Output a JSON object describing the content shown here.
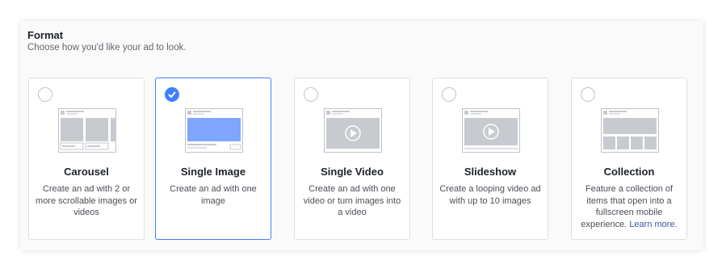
{
  "section": {
    "title": "Format",
    "subtitle": "Choose how you'd like your ad to look."
  },
  "formats": [
    {
      "name": "Carousel",
      "description": "Create an ad with 2 or more scrollable images or videos",
      "selected": false,
      "icon": "carousel-preview-icon"
    },
    {
      "name": "Single Image",
      "description": "Create an ad with one image",
      "selected": true,
      "icon": "single-image-preview-icon"
    },
    {
      "name": "Single Video",
      "description": "Create an ad with one video or turn images into a video",
      "selected": false,
      "icon": "single-video-preview-icon"
    },
    {
      "name": "Slideshow",
      "description": "Create a looping video ad with up to 10 images",
      "selected": false,
      "icon": "slideshow-preview-icon"
    },
    {
      "name": "Collection",
      "description": "Feature a collection of items that open into a fullscreen mobile experience.",
      "link": "Learn more.",
      "selected": false,
      "icon": "collection-preview-icon"
    }
  ],
  "colors": {
    "accent": "#4080ff",
    "border": "#dddfe2",
    "link": "#365899",
    "preview_gray": "#c7cacf",
    "selected_preview_fill": "#7ea6ff"
  }
}
